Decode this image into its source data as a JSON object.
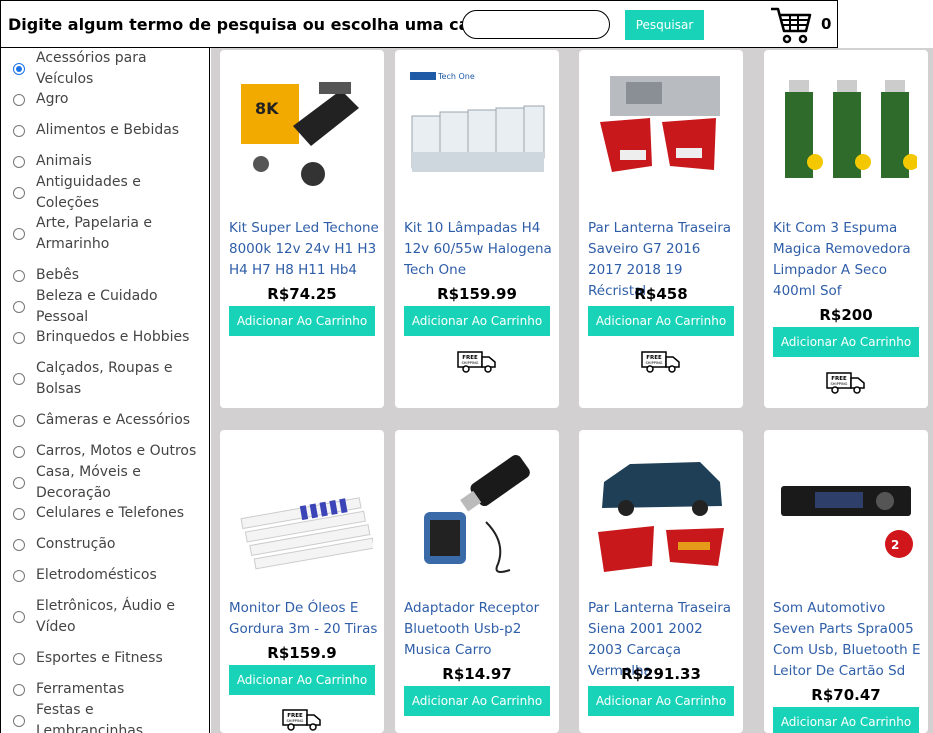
{
  "header": {
    "prompt": "Digite algum termo de pesquisa ou escolha uma categoria.",
    "search_button": "Pesquisar",
    "cart_count": "0"
  },
  "categories": [
    {
      "label": "Acessórios para Veículos",
      "selected": true
    },
    {
      "label": "Agro"
    },
    {
      "label": "Alimentos e Bebidas"
    },
    {
      "label": "Animais"
    },
    {
      "label": "Antiguidades e Coleções"
    },
    {
      "label": "Arte, Papelaria e Armarinho"
    },
    {
      "label": "Bebês"
    },
    {
      "label": "Beleza e Cuidado Pessoal"
    },
    {
      "label": "Brinquedos e Hobbies"
    },
    {
      "label": "Calçados, Roupas e Bolsas"
    },
    {
      "label": "Câmeras e Acessórios"
    },
    {
      "label": "Carros, Motos e Outros"
    },
    {
      "label": "Casa, Móveis e Decoração"
    },
    {
      "label": "Celulares e Telefones"
    },
    {
      "label": "Construção"
    },
    {
      "label": "Eletrodomésticos"
    },
    {
      "label": "Eletrônicos, Áudio e Vídeo"
    },
    {
      "label": "Esportes e Fitness"
    },
    {
      "label": "Ferramentas"
    },
    {
      "label": "Festas e Lembrancinhas"
    }
  ],
  "products": [
    {
      "title": "Kit Super Led Techone 8000k 12v 24v H1 H3 H4 H7 H8 H11 Hb4",
      "price": "R$74.25",
      "add_label": "Adicionar Ao Carrinho",
      "free_shipping": false,
      "image": "led-kit-image"
    },
    {
      "title": "Kit 10 Lâmpadas H4 12v 60/55w Halogena Tech One",
      "price": "R$159.99",
      "add_label": "Adicionar Ao Carrinho",
      "free_shipping": true,
      "image": "lamp-boxes-image"
    },
    {
      "title": "Par Lanterna Traseira Saveiro G7 2016 2017 2018 19 Récristal",
      "price": "R$458",
      "add_label": "Adicionar Ao Carrinho",
      "free_shipping": true,
      "image": "tail-light-image"
    },
    {
      "title": "Kit Com 3 Espuma Magica Removedora Limpador A Seco 400ml Sof",
      "price": "R$200",
      "add_label": "Adicionar Ao Carrinho",
      "free_shipping": true,
      "image": "spray-cans-image"
    },
    {
      "title": "Monitor De Óleos E Gordura 3m - 20 Tiras",
      "price": "R$159.9",
      "add_label": "Adicionar Ao Carrinho",
      "free_shipping": true,
      "image": "test-strips-image"
    },
    {
      "title": "Adaptador Receptor Bluetooth Usb-p2 Musica Carro",
      "price": "R$14.97",
      "add_label": "Adicionar Ao Carrinho",
      "free_shipping": false,
      "image": "bluetooth-adapter-image"
    },
    {
      "title": "Par Lanterna Traseira Siena 2001 2002 2003 Carcaça Vermelha",
      "price": "R$291.33",
      "add_label": "Adicionar Ao Carrinho",
      "free_shipping": false,
      "image": "car-tail-light-image"
    },
    {
      "title": "Som Automotivo Seven Parts Spra005 Com Usb, Bluetooth E Leitor De Cartão Sd",
      "price": "R$70.47",
      "add_label": "Adicionar Ao Carrinho",
      "free_shipping": false,
      "image": "car-stereo-image"
    }
  ],
  "shipping_badge": {
    "line1": "FREE",
    "line2": "SHIPPING"
  }
}
